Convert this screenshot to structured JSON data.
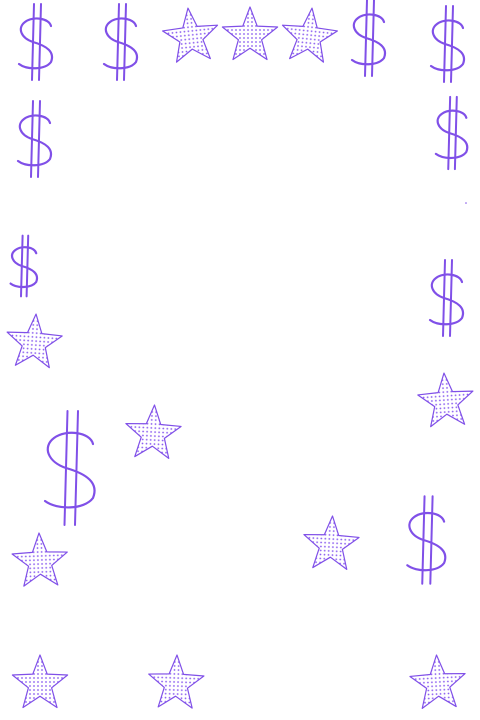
{
  "page": {
    "background": "#ffffff"
  },
  "palette": {
    "stroke": "#8050e8",
    "dot": "#8a5cf0",
    "fill": "#ffffff"
  },
  "icons": {
    "dollar": "dollar-sign-icon",
    "star": "dotted-star-icon"
  }
}
